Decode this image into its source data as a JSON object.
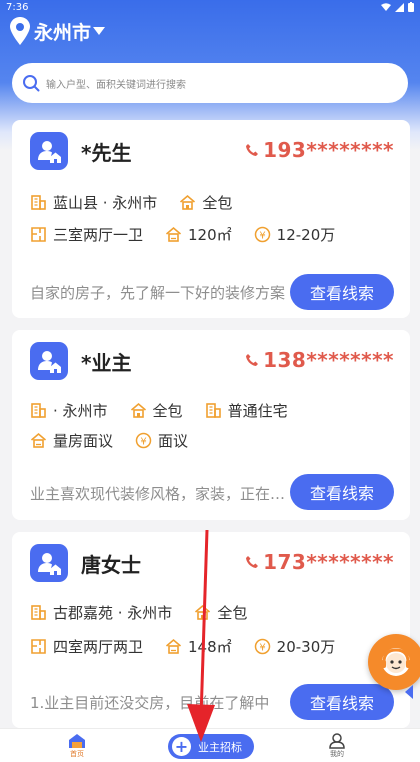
{
  "status_bar": {
    "time": "7:36"
  },
  "header": {
    "city": "永州市"
  },
  "search": {
    "placeholder": "输入户型、面积关键词进行搜索"
  },
  "listings": [
    {
      "name": "*先生",
      "phone": "193********",
      "row1": [
        "蓝山县 · 永州市",
        "全包"
      ],
      "row2": [
        "三室两厅一卫",
        "120㎡",
        "12-20万"
      ],
      "desc": "自家的房子，先了解一下好的装修方案",
      "button": "查看线索"
    },
    {
      "name": "*业主",
      "phone": "138********",
      "row1": [
        " · 永州市",
        "全包",
        "普通住宅"
      ],
      "row2": [
        "量房面议",
        "面议"
      ],
      "desc": "业主喜欢现代装修风格，家装，正在考虑",
      "button": "查看线索"
    },
    {
      "name": "唐女士",
      "phone": "173********",
      "row1": [
        "古郡嘉苑 · 永州市",
        "全包"
      ],
      "row2": [
        "四室两厅两卫",
        "148㎡",
        "20-30万"
      ],
      "desc": "1.业主目前还没交房，目前在了解中",
      "button": "查看线索"
    }
  ],
  "bottom_nav": {
    "home": "首页",
    "center": "业主招标",
    "mine": "我的"
  },
  "colors": {
    "primary": "#4a6cf0",
    "phone": "#e05a4c",
    "accent_orange": "#f58a2a"
  }
}
